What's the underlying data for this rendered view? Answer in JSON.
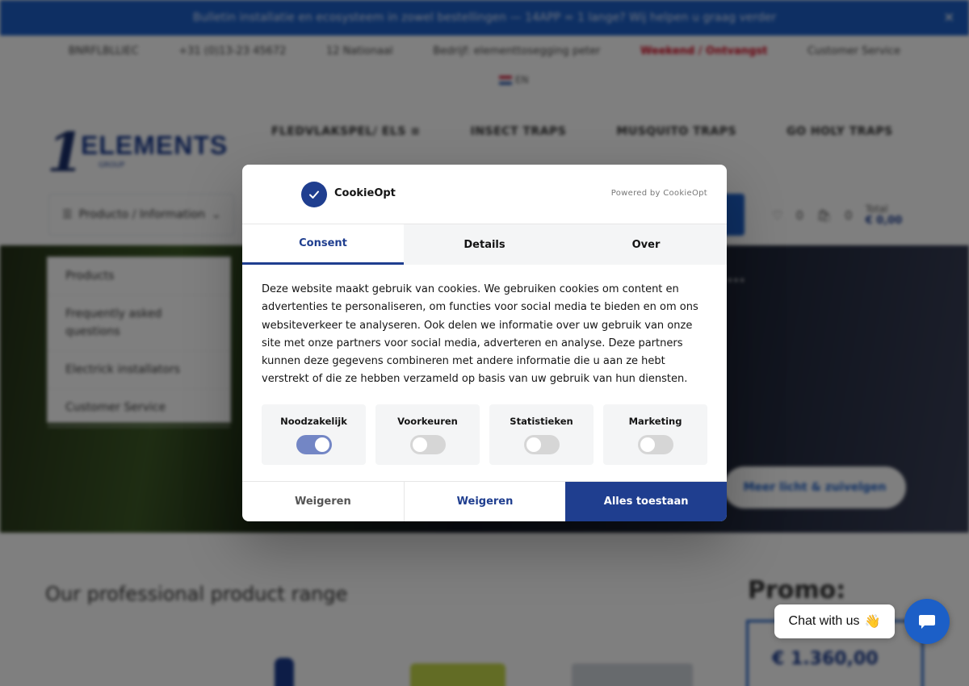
{
  "site": {
    "announcement": "Bulletin installatie en ecosysteem in zowel bestellingen — 14APP = 1 lange? Wij helpen u graag verder",
    "topbar": [
      "BNRFLBLLIEC",
      "+31 (0)13-23 45672",
      "12 Nationaal",
      "Bedrijf: elementtosegging peter",
      "Weekend / Ontvangst",
      "Customer Service"
    ],
    "topbar_highlight_index": 4,
    "language": "EN",
    "logo": {
      "mark": "1",
      "word": "ELEMENTS",
      "sub": "GROUP"
    },
    "nav": [
      "FLEDVLAKSPEL/ ELS ≡",
      "INSECT TRAPS",
      "MUSQUITO TRAPS",
      "GO HOLY TRAPS"
    ],
    "products_button": "Producto / Information",
    "wishlist_count": "0",
    "cart_count": "0",
    "cart_total_label": "Total",
    "cart_total_value": "€ 0,00",
    "hero_heading": "...",
    "hero_button": "Meer licht & zuivelgen",
    "dropdown_items": [
      "Products",
      "Frequently asked questions",
      "Electrick installators",
      "Customer Service"
    ],
    "section_title": "Our professional product range",
    "promo_title": "Promo:",
    "promo_price": "€ 1.360,00"
  },
  "cookie": {
    "brand": "CookieOpt",
    "powered_by": "Powered by CookieOpt",
    "tabs": [
      {
        "label": "Consent",
        "active": true
      },
      {
        "label": "Details",
        "active": false
      },
      {
        "label": "Over",
        "active": false
      }
    ],
    "description": "Deze website maakt gebruik van cookies. We gebruiken cookies om content en advertenties te personaliseren, om functies voor social media te bieden en om ons websiteverkeer te analyseren. Ook delen we informatie over uw gebruik van onze site met onze partners voor social media, adverteren en analyse. Deze partners kunnen deze gegevens combineren met andere informatie die u aan ze hebt verstrekt of die ze hebben verzameld op basis van uw gebruik van hun diensten.",
    "categories": [
      {
        "label": "Noodzakelijk",
        "enabled": true
      },
      {
        "label": "Voorkeuren",
        "enabled": false
      },
      {
        "label": "Statistieken",
        "enabled": false
      },
      {
        "label": "Marketing",
        "enabled": false
      }
    ],
    "buttons": {
      "reject": "Weigeren",
      "reject_secondary": "Weigeren",
      "allow_all": "Alles toestaan"
    },
    "colors": {
      "primary": "#1f3e8f",
      "toggle_on": "#7386c5",
      "toggle_off": "#d6d6d6"
    }
  },
  "chat": {
    "label": "Chat with us",
    "emoji": "👋",
    "accent": "#1c5fc7"
  }
}
